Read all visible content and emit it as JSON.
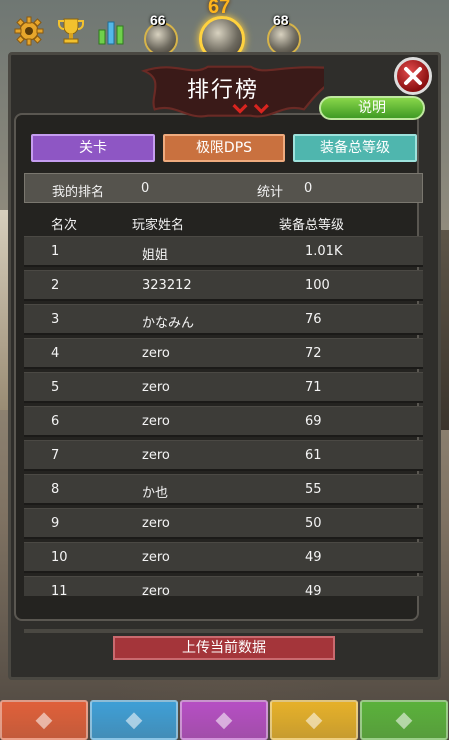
{
  "top_bar": {
    "coins": [
      {
        "value": "66"
      },
      {
        "value": "67"
      },
      {
        "value": "68"
      }
    ]
  },
  "title": "排行榜",
  "desc_button": "说明",
  "tabs": [
    {
      "label": "关卡",
      "color": "#8e56c4"
    },
    {
      "label": "极限DPS",
      "color": "#c9713f"
    },
    {
      "label": "装备总等级",
      "color": "#4fb6ae"
    }
  ],
  "info": {
    "my_rank_label": "我的排名",
    "my_rank_value": "0",
    "stats_label": "统计",
    "stats_value": "0"
  },
  "columns": [
    "名次",
    "玩家姓名",
    "装备总等级"
  ],
  "rows": [
    {
      "rank": "1",
      "name": "姐姐",
      "score": "1.01K"
    },
    {
      "rank": "2",
      "name": "323212",
      "score": "100"
    },
    {
      "rank": "3",
      "name": "かなみん",
      "score": "76"
    },
    {
      "rank": "4",
      "name": "zero",
      "score": "72"
    },
    {
      "rank": "5",
      "name": "zero",
      "score": "71"
    },
    {
      "rank": "6",
      "name": "zero",
      "score": "69"
    },
    {
      "rank": "7",
      "name": "zero",
      "score": "61"
    },
    {
      "rank": "8",
      "name": "か也",
      "score": "55"
    },
    {
      "rank": "9",
      "name": "zero",
      "score": "50"
    },
    {
      "rank": "10",
      "name": "zero",
      "score": "49"
    },
    {
      "rank": "11",
      "name": "zero",
      "score": "49"
    }
  ],
  "upload_button": "上传当前数据",
  "bottom_nav": [
    {
      "icon": "scroll-icon",
      "color": "#e0603a"
    },
    {
      "icon": "wolf-icon",
      "color": "#3f9fd6"
    },
    {
      "icon": "helmet-icon",
      "color": "#b64fc4"
    },
    {
      "icon": "pig-icon",
      "color": "#e6b12a"
    },
    {
      "icon": "treasure-icon",
      "color": "#5ab23b"
    }
  ],
  "colors": {
    "panel_bg": "#2f2e2b",
    "row_bg": "#3d3c38",
    "upload_btn": "#a4353a",
    "desc_btn": "#5db532"
  }
}
